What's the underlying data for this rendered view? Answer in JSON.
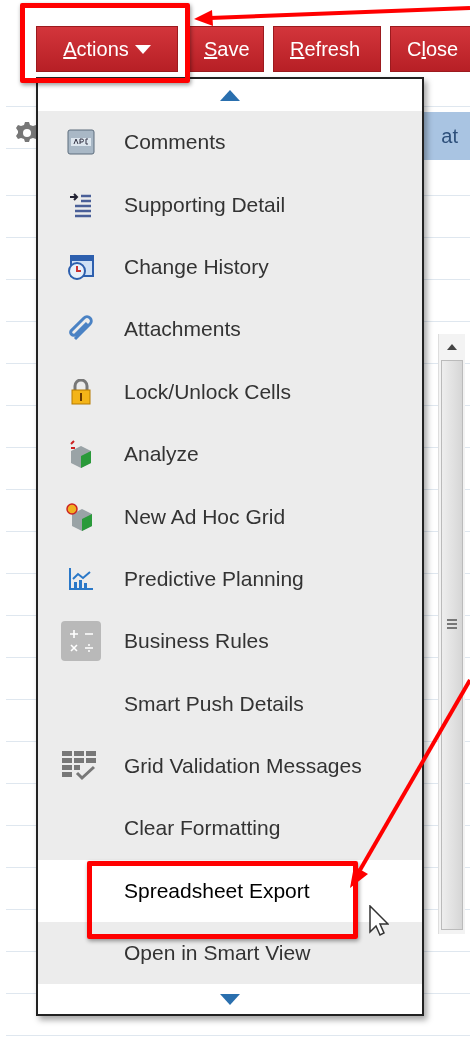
{
  "toolbar": {
    "buttons": [
      {
        "kind": "menu",
        "access_key": "A",
        "rest": "ctions"
      },
      {
        "kind": "plain",
        "access_key": "S",
        "rest": "ave"
      },
      {
        "kind": "plain",
        "access_key": "R",
        "rest": "efresh"
      },
      {
        "kind": "plain",
        "lead": "C",
        "access_key": "l",
        "rest": "ose"
      }
    ]
  },
  "background": {
    "header_text": "at"
  },
  "actions_menu": {
    "items": [
      {
        "label": "Comments",
        "selected": false
      },
      {
        "label": "Supporting Detail",
        "selected": false
      },
      {
        "label": "Change History",
        "selected": false
      },
      {
        "label": "Attachments",
        "selected": false
      },
      {
        "label": "Lock/Unlock Cells",
        "selected": false
      },
      {
        "label": "Analyze",
        "selected": false
      },
      {
        "label": "New Ad Hoc Grid",
        "selected": false
      },
      {
        "label": "Predictive Planning",
        "selected": false
      },
      {
        "label": "Business Rules",
        "selected": false
      },
      {
        "label": "Smart Push Details",
        "selected": false
      },
      {
        "label": "Grid Validation Messages",
        "selected": false
      },
      {
        "label": "Clear Formatting",
        "selected": false
      },
      {
        "label": "Spreadsheet Export",
        "selected": true
      },
      {
        "label": "Open in Smart View",
        "selected": false
      }
    ]
  }
}
